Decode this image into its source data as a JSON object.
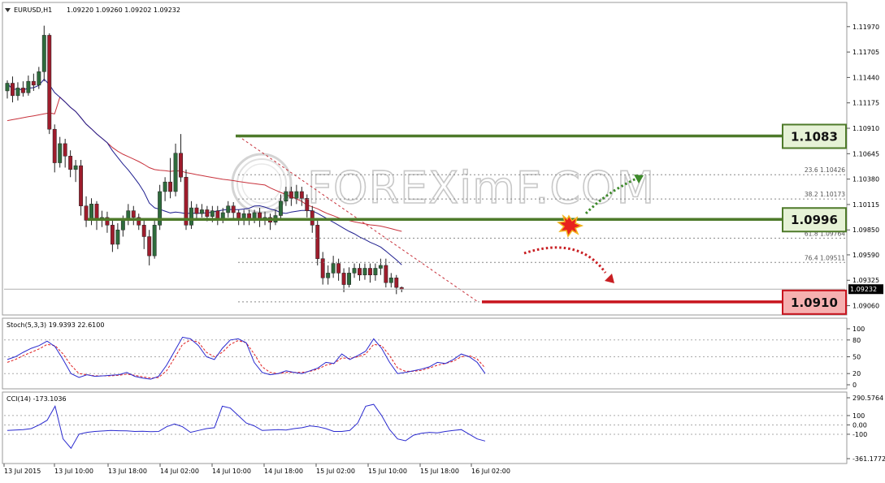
{
  "header": {
    "symbol": "EURUSD,H1",
    "ohlc": "1.09220 1.09260 1.09202 1.09232",
    "stoch_label": "Stoch(5,3,3) 19.9393 22.6100",
    "cci_label": "CCI(14) -173.1036",
    "watermark": "FOREXimF.COM"
  },
  "colors": {
    "bull": "#2e6b3c",
    "bear": "#9e1c2c",
    "ma_fast": "#1f1f8f",
    "ma_slow": "#c8323c",
    "level_green": "#4e7a2a",
    "level_red": "#c8141e",
    "label_green_bg": "#e6f2d6",
    "label_red_bg": "#f6b0b0",
    "osc_main": "#2a2acf",
    "osc_signal": "#e02020"
  },
  "chart_data": [
    {
      "type": "candlestick",
      "title": "EURUSD,H1",
      "ylim": [
        1.0898,
        1.1218
      ],
      "y_ticks": [
        "1.11970",
        "1.11705",
        "1.11440",
        "1.11175",
        "1.10910",
        "1.10645",
        "1.10380",
        "1.10115",
        "1.09850",
        "1.09590",
        "1.09325",
        "1.09060"
      ],
      "current_price": "1.09232",
      "x_tick_labels": [
        "13 Jul 2015",
        "13 Jul 10:00",
        "13 Jul 18:00",
        "14 Jul 02:00",
        "14 Jul 10:00",
        "14 Jul 18:00",
        "15 Jul 02:00",
        "15 Jul 10:00",
        "15 Jul 18:00",
        "16 Jul 02:00"
      ],
      "moving_averages": [
        "fast",
        "slow"
      ],
      "levels": [
        {
          "label": "1.1083",
          "value": 1.1083,
          "style": "resistance"
        },
        {
          "label": "1.0996",
          "value": 1.0996,
          "style": "pivot"
        },
        {
          "label": "1.0910",
          "value": 1.091,
          "style": "support"
        }
      ],
      "fibonacci": [
        {
          "ratio": "23.6",
          "price": "1.10426",
          "value": 1.10426
        },
        {
          "ratio": "38.2",
          "price": "1.10173",
          "value": 1.10173
        },
        {
          "ratio": "61.8",
          "price": "1.09764",
          "value": 1.09764
        },
        {
          "ratio": "76.4",
          "price": "1.09511",
          "value": 1.09511
        }
      ]
    },
    {
      "type": "line",
      "title": "Stoch(5,3,3) 19.9393 22.6100",
      "ylim": [
        0,
        100
      ],
      "y_ticks": [
        "100",
        "80",
        "50",
        "20",
        "0"
      ],
      "series": [
        {
          "name": "main",
          "values": [
            45,
            50,
            58,
            65,
            70,
            78,
            68,
            45,
            20,
            13,
            18,
            15,
            16,
            17,
            18,
            22,
            15,
            12,
            10,
            15,
            35,
            60,
            85,
            82,
            70,
            50,
            45,
            65,
            80,
            82,
            75,
            40,
            22,
            18,
            20,
            25,
            22,
            20,
            25,
            30,
            40,
            38,
            55,
            45,
            52,
            60,
            82,
            65,
            40,
            20,
            22,
            25,
            28,
            32,
            40,
            38,
            45,
            55,
            50,
            40,
            20
          ]
        },
        {
          "name": "signal",
          "values": [
            40,
            45,
            52,
            58,
            64,
            72,
            70,
            55,
            35,
            20,
            18,
            16,
            16,
            16,
            17,
            19,
            17,
            14,
            12,
            13,
            25,
            48,
            72,
            80,
            76,
            58,
            50,
            58,
            72,
            79,
            75,
            55,
            32,
            22,
            20,
            22,
            22,
            22,
            24,
            28,
            35,
            38,
            48,
            47,
            50,
            55,
            72,
            70,
            52,
            30,
            24,
            24,
            26,
            30,
            35,
            38,
            42,
            50,
            52,
            46,
            30
          ]
        }
      ]
    },
    {
      "type": "line",
      "title": "CCI(14) -173.1036",
      "ylim": [
        -361.1772,
        290.5764
      ],
      "y_ticks": [
        "290.5764",
        "100",
        "0.00",
        "-100",
        "-361.1772"
      ],
      "series": [
        {
          "name": "CCI(14)",
          "values": [
            -60,
            -55,
            -50,
            -40,
            0,
            50,
            200,
            -150,
            -250,
            -100,
            -80,
            -70,
            -65,
            -60,
            -62,
            -64,
            -70,
            -68,
            -72,
            -70,
            -20,
            10,
            -20,
            -80,
            -60,
            -40,
            -30,
            200,
            180,
            100,
            20,
            -10,
            -60,
            -55,
            -50,
            -55,
            -40,
            -30,
            -10,
            -20,
            -40,
            -70,
            -70,
            -60,
            20,
            200,
            220,
            100,
            -50,
            -150,
            -170,
            -110,
            -90,
            -80,
            -85,
            -70,
            -60,
            -50,
            -100,
            -150,
            -173
          ]
        }
      ]
    }
  ]
}
